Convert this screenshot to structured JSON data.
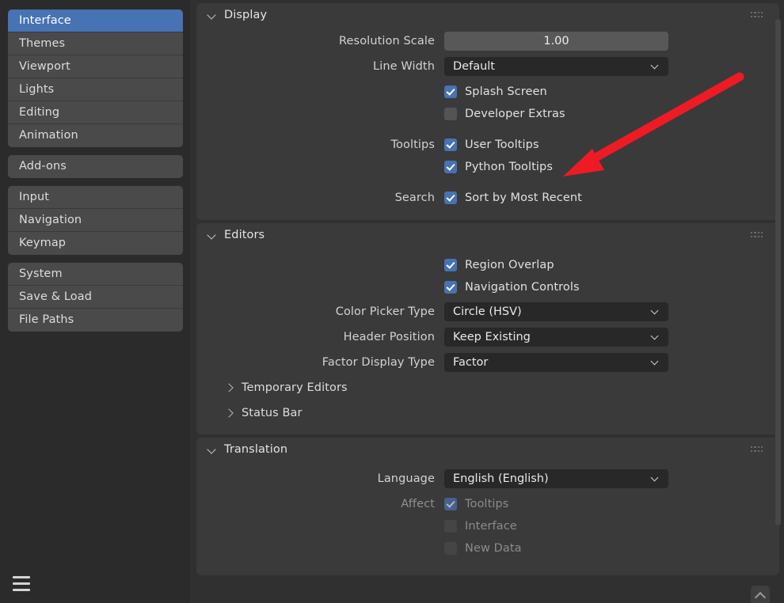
{
  "sidebar": {
    "groups": [
      {
        "items": [
          {
            "label": "Interface",
            "active": true
          },
          {
            "label": "Themes",
            "active": false
          },
          {
            "label": "Viewport",
            "active": false
          },
          {
            "label": "Lights",
            "active": false
          },
          {
            "label": "Editing",
            "active": false
          },
          {
            "label": "Animation",
            "active": false
          }
        ]
      },
      {
        "items": [
          {
            "label": "Add-ons",
            "active": false
          }
        ]
      },
      {
        "items": [
          {
            "label": "Input",
            "active": false
          },
          {
            "label": "Navigation",
            "active": false
          },
          {
            "label": "Keymap",
            "active": false
          }
        ]
      },
      {
        "items": [
          {
            "label": "System",
            "active": false
          },
          {
            "label": "Save & Load",
            "active": false
          },
          {
            "label": "File Paths",
            "active": false
          }
        ]
      }
    ],
    "menu_icon": "hamburger-menu-icon"
  },
  "panels": {
    "display": {
      "title": "Display",
      "expanded": true,
      "resolution_scale": {
        "label": "Resolution Scale",
        "value": "1.00"
      },
      "line_width": {
        "label": "Line Width",
        "value": "Default"
      },
      "splash_screen": {
        "label": "Splash Screen",
        "checked": true
      },
      "developer_extras": {
        "label": "Developer Extras",
        "checked": false
      },
      "tooltips_label": "Tooltips",
      "user_tooltips": {
        "label": "User Tooltips",
        "checked": true
      },
      "python_tooltips": {
        "label": "Python Tooltips",
        "checked": true
      },
      "search_label": "Search",
      "sort_by_most_recent": {
        "label": "Sort by Most Recent",
        "checked": true
      }
    },
    "editors": {
      "title": "Editors",
      "expanded": true,
      "region_overlap": {
        "label": "Region Overlap",
        "checked": true
      },
      "navigation_controls": {
        "label": "Navigation Controls",
        "checked": true
      },
      "color_picker_type": {
        "label": "Color Picker Type",
        "value": "Circle (HSV)"
      },
      "header_position": {
        "label": "Header Position",
        "value": "Keep Existing"
      },
      "factor_display_type": {
        "label": "Factor Display Type",
        "value": "Factor"
      },
      "temporary_editors": {
        "label": "Temporary Editors",
        "expanded": false
      },
      "status_bar": {
        "label": "Status Bar",
        "expanded": false
      }
    },
    "translation": {
      "title": "Translation",
      "expanded": true,
      "language": {
        "label": "Language",
        "value": "English (English)"
      },
      "affect_label": "Affect",
      "affect_tooltips": {
        "label": "Tooltips",
        "checked": true,
        "disabled": true
      },
      "affect_interface": {
        "label": "Interface",
        "checked": false,
        "disabled": true
      },
      "affect_new_data": {
        "label": "New Data",
        "checked": false,
        "disabled": true
      }
    }
  },
  "annotation": {
    "type": "arrow",
    "color": "#ee1b24",
    "points_to": "Python Tooltips"
  },
  "colors": {
    "accent": "#4772b3",
    "panel_bg": "#3a3a3a",
    "window_bg": "#303030",
    "sidebar_bg": "#2b2b2b",
    "field_dark": "#282828",
    "field_light": "#585858"
  },
  "icons": {
    "grip": "drag-grip-icon",
    "chevron_down": "chevron-down-icon",
    "chevron_right": "chevron-right-icon",
    "scroll_up": "scroll-up-icon"
  }
}
